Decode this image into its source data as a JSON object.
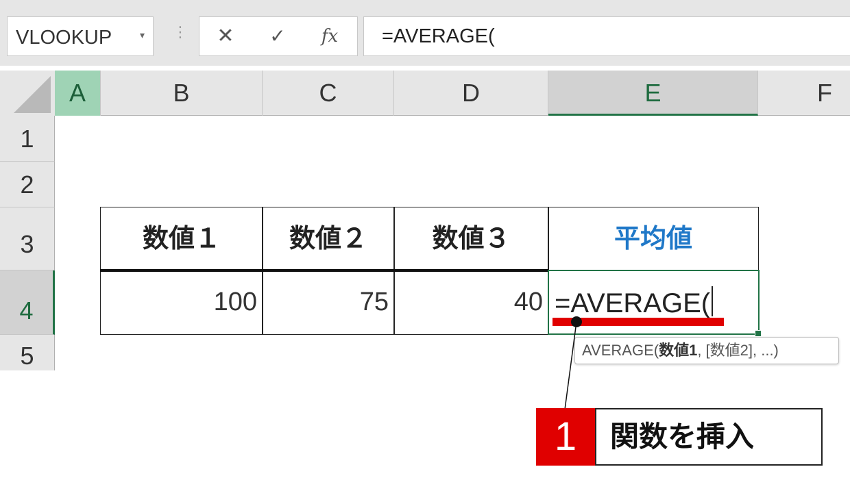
{
  "formula_bar": {
    "name_box": "VLOOKUP",
    "cancel_icon": "✕",
    "enter_icon": "✓",
    "fx_label": "fx",
    "formula": "=AVERAGE("
  },
  "columns": [
    "A",
    "B",
    "C",
    "D",
    "E",
    "F"
  ],
  "rows": [
    "1",
    "2",
    "3",
    "4",
    "5"
  ],
  "table": {
    "headers": [
      "数値１",
      "数値２",
      "数値３",
      "平均値"
    ],
    "values": [
      "100",
      "75",
      "40"
    ],
    "active_cell_text": "=AVERAGE("
  },
  "tooltip": {
    "function_name": "AVERAGE(",
    "arg1": "数値1",
    "rest": ", [数値2], ...)"
  },
  "callout": {
    "step_number": "1",
    "step_text": "関数を挿入"
  },
  "colors": {
    "excel_green": "#217346",
    "accent_red": "#e00000",
    "header_blue": "#1f78c8"
  }
}
